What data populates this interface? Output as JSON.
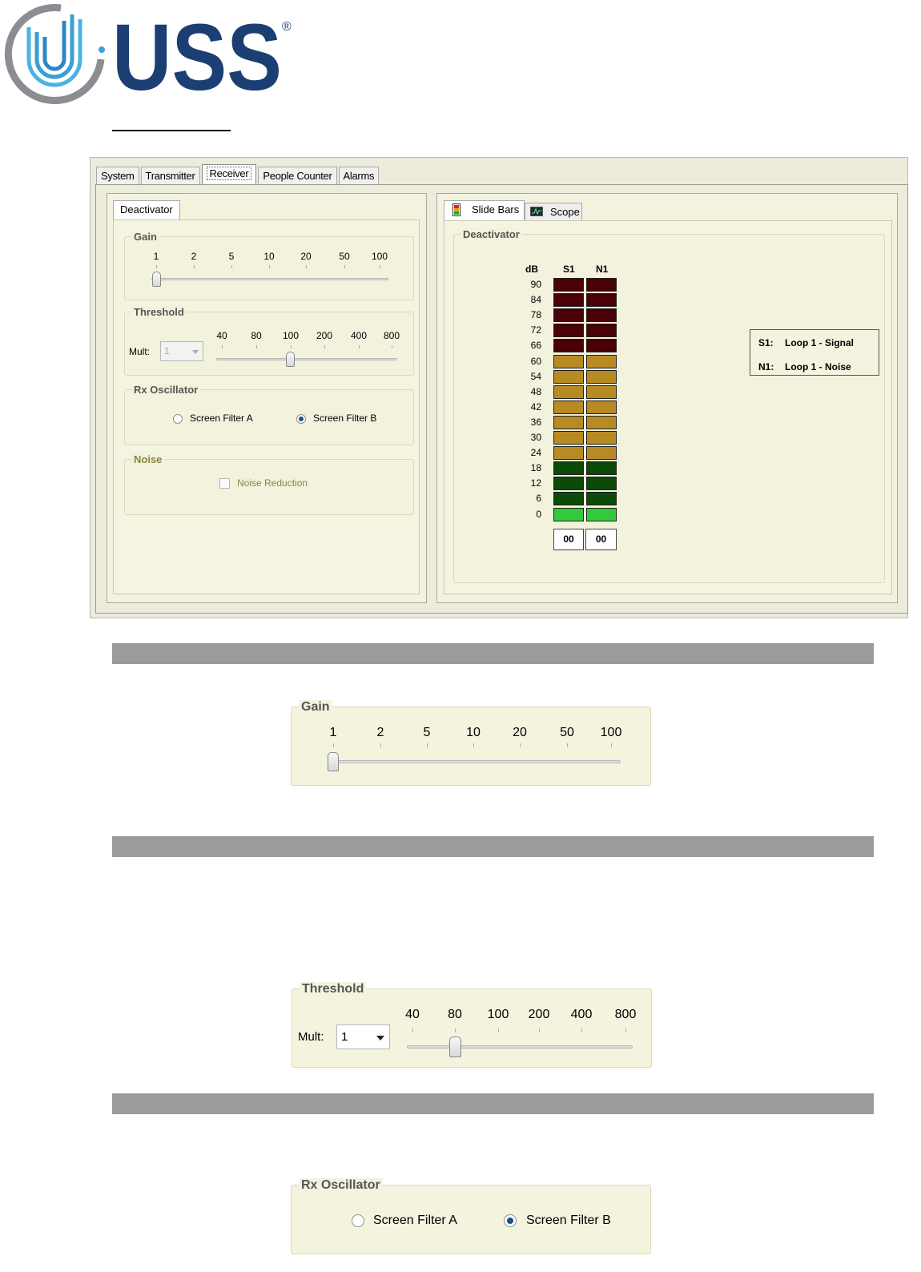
{
  "brand": {
    "name": "USS",
    "registered_mark": "®",
    "colors": {
      "navy": "#1c3f73",
      "light_blue": "#3ea3d9",
      "gray_ring": "#8a8d91"
    }
  },
  "window": {
    "tabs": [
      {
        "label": "System",
        "active": false
      },
      {
        "label": "Transmitter",
        "active": false
      },
      {
        "label": "Receiver",
        "active": true
      },
      {
        "label": "People Counter",
        "active": false
      },
      {
        "label": "Alarms",
        "active": false
      }
    ]
  },
  "left_panel": {
    "tab_label": "Deactivator",
    "gain": {
      "label": "Gain",
      "ticks": [
        "1",
        "2",
        "5",
        "10",
        "20",
        "50",
        "100"
      ],
      "selected_index": 0
    },
    "threshold": {
      "label": "Threshold",
      "mult_label": "Mult:",
      "mult_value": "1",
      "ticks": [
        "40",
        "80",
        "100",
        "200",
        "400",
        "800"
      ],
      "selected_index": 2
    },
    "rx_oscillator": {
      "label": "Rx Oscillator",
      "option_a": "Screen Filter A",
      "option_b": "Screen Filter B",
      "selected": "b"
    },
    "noise": {
      "label": "Noise",
      "checkbox_label": "Noise Reduction",
      "checked": false
    }
  },
  "right_panel": {
    "tabs": [
      {
        "label": "Slide Bars",
        "icon": "bar-meter-icon",
        "active": true
      },
      {
        "label": "Scope",
        "icon": "scope-icon",
        "active": false
      }
    ],
    "group_label": "Deactivator",
    "meter": {
      "db_header": "dB",
      "columns": [
        "S1",
        "N1"
      ],
      "db_levels": [
        "90",
        "84",
        "78",
        "72",
        "66",
        "60",
        "54",
        "48",
        "42",
        "36",
        "30",
        "24",
        "18",
        "12",
        "6",
        "0"
      ],
      "readouts": [
        "00",
        "00"
      ],
      "colors": {
        "dark_red": "#4a0007",
        "amber": "#b88a24",
        "dark_green": "#0b4a08",
        "bright_green": "#34c83c"
      }
    },
    "legend": [
      {
        "key": "S1:",
        "value": "Loop 1 - Signal"
      },
      {
        "key": "N1:",
        "value": "Loop 1 - Noise"
      }
    ]
  },
  "zoom_gain": {
    "label": "Gain",
    "ticks": [
      "1",
      "2",
      "5",
      "10",
      "20",
      "50",
      "100"
    ],
    "selected_index": 0
  },
  "zoom_threshold": {
    "label": "Threshold",
    "mult_label": "Mult:",
    "mult_value": "1",
    "ticks": [
      "40",
      "80",
      "100",
      "200",
      "400",
      "800"
    ],
    "selected_index": 1
  },
  "zoom_rx": {
    "label": "Rx Oscillator",
    "option_a": "Screen Filter A",
    "option_b": "Screen Filter B",
    "selected": "b"
  }
}
